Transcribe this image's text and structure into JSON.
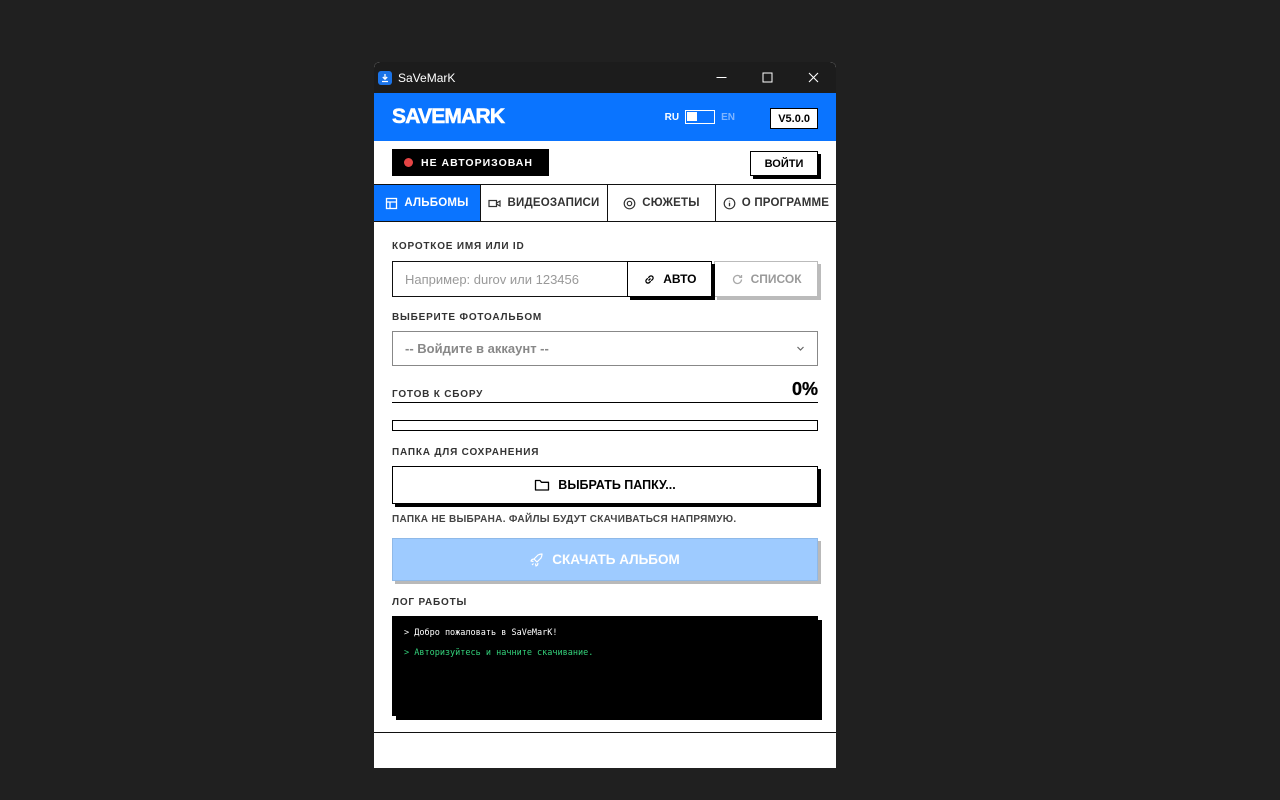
{
  "window": {
    "title": "SaVeMarK"
  },
  "header": {
    "brand": "SAVEMARK",
    "lang_ru": "RU",
    "lang_en": "EN",
    "version": "V5.0.0"
  },
  "auth": {
    "status": "НЕ АВТОРИЗОВАН",
    "login_label": "ВОЙТИ"
  },
  "tabs": [
    {
      "label": "АЛЬБОМЫ",
      "icon": "layout-icon"
    },
    {
      "label": "ВИДЕОЗАПИСИ",
      "icon": "video-icon"
    },
    {
      "label": "СЮЖЕТЫ",
      "icon": "target-icon"
    },
    {
      "label": "О ПРОГРАММЕ",
      "icon": "info-icon"
    }
  ],
  "form": {
    "id_label": "КОРОТКОЕ ИМЯ ИЛИ ID",
    "id_placeholder": "Например: durov или 123456",
    "id_value": "",
    "auto_label": "АВТО",
    "list_label": "СПИСОК",
    "album_label": "ВЫБЕРИТЕ ФОТОАЛЬБОМ",
    "album_selected": "-- Войдите в аккаунт --",
    "ready_label": "ГОТОВ К СБОРУ",
    "progress_text": "0%",
    "progress_value": 0,
    "folder_label": "ПАПКА ДЛЯ СОХРАНЕНИЯ",
    "folder_button": "ВЫБРАТЬ ПАПКУ...",
    "folder_note": "ПАПКА НЕ ВЫБРАНА. ФАЙЛЫ БУДУТ СКАЧИВАТЬСЯ НАПРЯМУЮ.",
    "download_button": "СКАЧАТЬ АЛЬБОМ"
  },
  "log": {
    "label": "ЛОГ РАБОТЫ",
    "lines": [
      "> Добро пожаловать в SaVeMarK!",
      "> Авторизуйтесь и начните скачивание."
    ]
  },
  "colors": {
    "accent": "#0a74ff",
    "error_dot": "#e64545",
    "log_green": "#33d17a",
    "disabled_button": "#9ecbff"
  }
}
